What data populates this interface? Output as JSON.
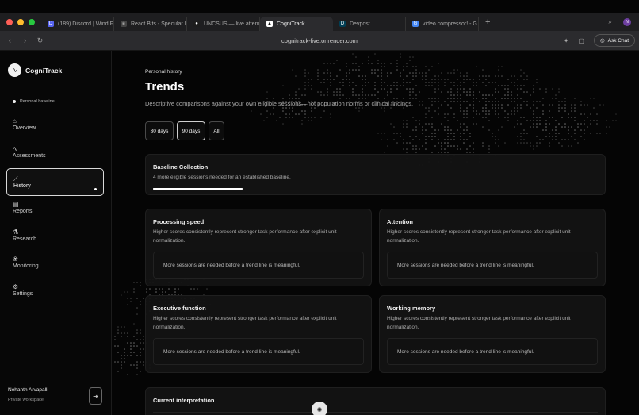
{
  "browser": {
    "tabs": [
      {
        "label": "(189) Discord | Wind F",
        "favicon_color": "#5865f2",
        "favicon_glyph": "D"
      },
      {
        "label": "React Bits - Specular I",
        "favicon_color": "#444444",
        "favicon_glyph": "⚛"
      },
      {
        "label": "UNCSUS — live attenc",
        "favicon_color": "#1d1d1d",
        "favicon_glyph": "●"
      },
      {
        "label": "CogniTrack",
        "favicon_color": "#ffffff",
        "favicon_glyph": "▲",
        "active": true
      },
      {
        "label": "Devpost",
        "favicon_color": "#003e54",
        "favicon_glyph": "D"
      },
      {
        "label": "video compressor! - G",
        "favicon_color": "#4285f4",
        "favicon_glyph": "G"
      }
    ],
    "url": "cognitrack-live.onrender.com",
    "ask_chat_label": "Ask Chat"
  },
  "sidebar": {
    "logo_text": "CogniTrack",
    "baseline_label": "Personal baseline",
    "items": [
      {
        "label": "Overview",
        "icon": "home-icon",
        "glyph": "⌂"
      },
      {
        "label": "Assessments",
        "icon": "activity-icon",
        "glyph": "∿"
      },
      {
        "label": "History",
        "icon": "chart-line-icon",
        "glyph": "⟋",
        "active": true
      },
      {
        "label": "Reports",
        "icon": "document-icon",
        "glyph": "▤"
      },
      {
        "label": "Research",
        "icon": "flask-icon",
        "glyph": "⚗"
      },
      {
        "label": "Monitoring",
        "icon": "brain-icon",
        "glyph": "❀"
      },
      {
        "label": "Settings",
        "icon": "gear-icon",
        "glyph": "⚙"
      }
    ],
    "user_name": "Nehanth Arvapalli",
    "user_subtitle": "Private workspace"
  },
  "main": {
    "eyebrow": "Personal history",
    "title": "Trends",
    "subtitle": "Descriptive comparisons against your own eligible sessions—not population norms or clinical findings.",
    "ranges": [
      {
        "label": "30 days"
      },
      {
        "label": "90 days",
        "selected": true
      },
      {
        "label": "All"
      }
    ],
    "baseline_card": {
      "title": "Baseline Collection",
      "description": "4 more eligible sessions needed for an established baseline.",
      "progress": 1.0
    },
    "metrics": [
      {
        "title": "Processing speed",
        "description": "Higher scores consistently represent stronger task performance after explicit unit normalization.",
        "empty": "More sessions are needed before a trend line is meaningful."
      },
      {
        "title": "Attention",
        "description": "Higher scores consistently represent stronger task performance after explicit unit normalization.",
        "empty": "More sessions are needed before a trend line is meaningful."
      },
      {
        "title": "Executive function",
        "description": "Higher scores consistently represent stronger task performance after explicit unit normalization.",
        "empty": "More sessions are needed before a trend line is meaningful."
      },
      {
        "title": "Working memory",
        "description": "Higher scores consistently represent stronger task performance after explicit unit normalization.",
        "empty": "More sessions are needed before a trend line is meaningful."
      }
    ],
    "interpretation_title": "Current interpretation"
  }
}
